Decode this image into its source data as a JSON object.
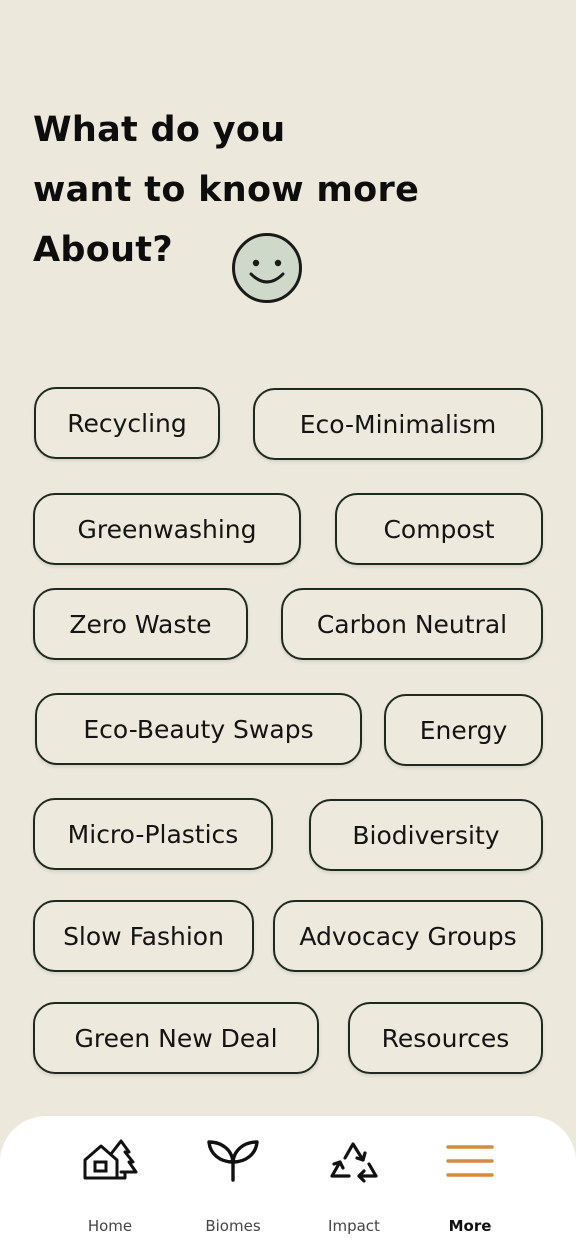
{
  "heading": {
    "line1": "What do you",
    "line2": "want to know more",
    "line3": "About?"
  },
  "topics": [
    "Recycling",
    "Eco-Minimalism",
    "Greenwashing",
    "Compost",
    "Zero Waste",
    "Carbon Neutral",
    "Eco-Beauty Swaps",
    "Energy",
    "Micro-Plastics",
    "Biodiversity",
    "Slow Fashion",
    "Advocacy Groups",
    "Green New Deal",
    "Resources"
  ],
  "nav": {
    "items": [
      {
        "label": "Home",
        "icon": "home-icon",
        "active": false
      },
      {
        "label": "Biomes",
        "icon": "sprout-icon",
        "active": false
      },
      {
        "label": "Impact",
        "icon": "recycle-icon",
        "active": false
      },
      {
        "label": "More",
        "icon": "menu-icon",
        "active": true
      }
    ],
    "active_color": "#d8893a"
  },
  "colors": {
    "background": "#ede8dc",
    "smiley_fill": "#cfd9c9",
    "chip_border": "#1f2a1f"
  }
}
